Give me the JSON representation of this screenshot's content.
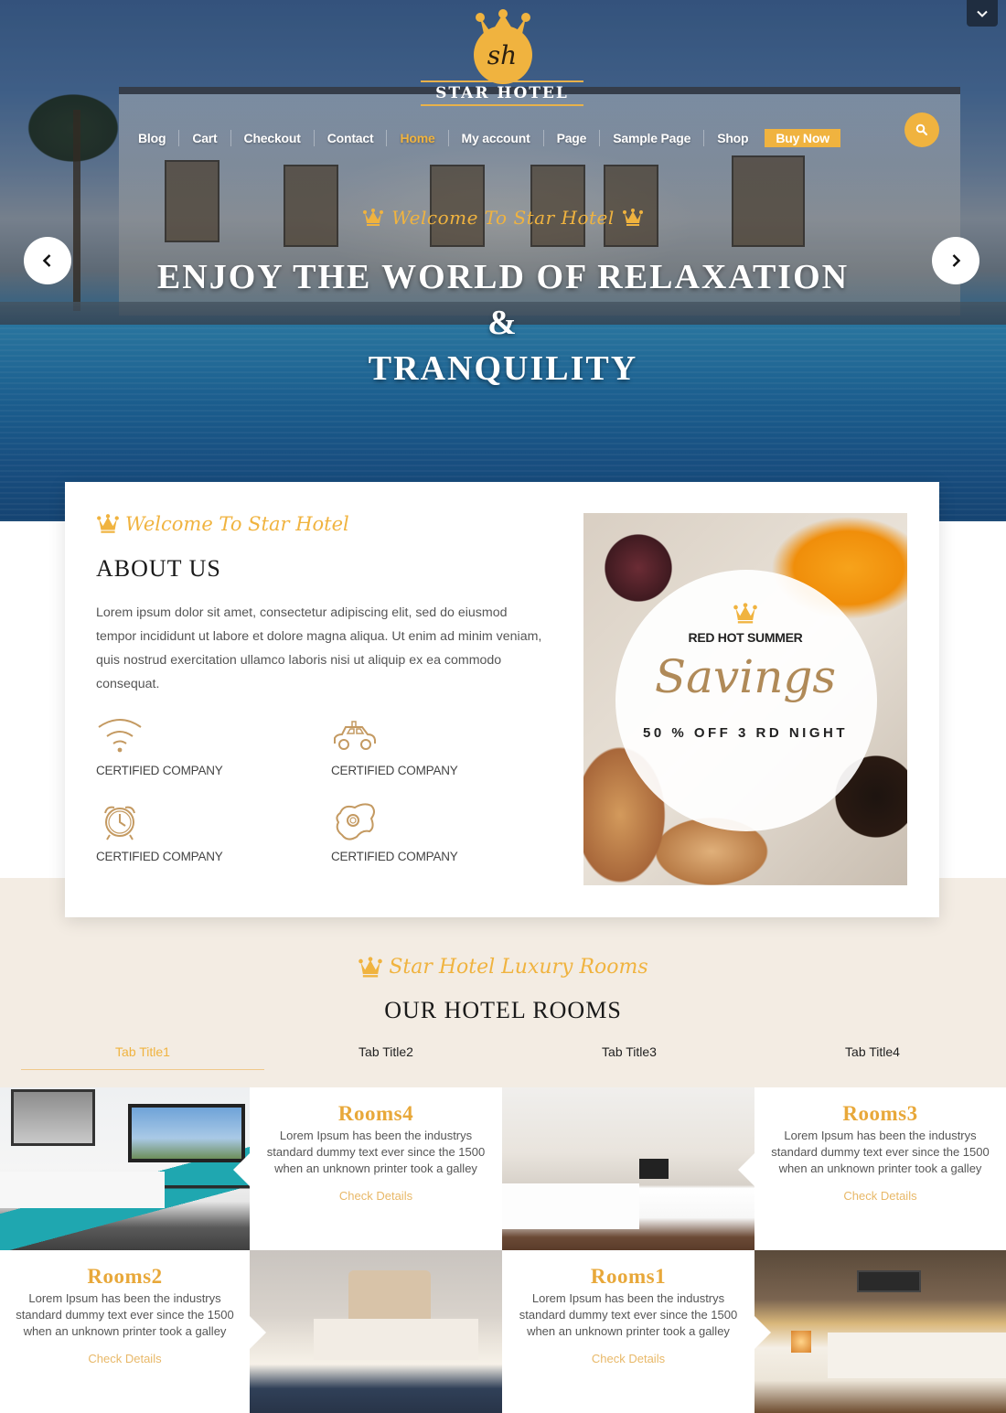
{
  "brand": {
    "initials": "sh",
    "name": "STAR HOTEL"
  },
  "colors": {
    "accent": "#f0b33f",
    "beige": "#f3ece3",
    "dark": "#1a1a1a",
    "icon_tan": "#c49a62"
  },
  "nav": {
    "items": [
      {
        "label": "Blog"
      },
      {
        "label": "Cart"
      },
      {
        "label": "Checkout"
      },
      {
        "label": "Contact"
      },
      {
        "label": "Home",
        "active": true
      },
      {
        "label": "My account"
      },
      {
        "label": "Page"
      },
      {
        "label": "Sample Page"
      },
      {
        "label": "Shop"
      }
    ],
    "buy_now": "Buy Now",
    "search_icon": "search-icon"
  },
  "hero": {
    "subtitle": "Welcome To Star Hotel",
    "title_line1": "ENJOY THE WORLD OF RELAXATION &",
    "title_line2": "TRANQUILITY",
    "prev_icon": "chevron-left-icon",
    "next_icon": "chevron-right-icon"
  },
  "about": {
    "subtitle": "Welcome To Star Hotel",
    "title": "ABOUT US",
    "text": "Lorem ipsum dolor sit amet, consectetur adipiscing elit, sed do eiusmod tempor incididunt ut labore et dolore magna aliqua. Ut enim ad minim veniam, quis nostrud exercitation ullamco laboris nisi ut aliquip ex ea commodo consequat.",
    "features": [
      {
        "icon": "wifi-icon",
        "label": "CERTIFIED COMPANY"
      },
      {
        "icon": "taxi-icon",
        "label": "CERTIFIED COMPANY"
      },
      {
        "icon": "alarm-clock-icon",
        "label": "CERTIFIED COMPANY"
      },
      {
        "icon": "fried-egg-icon",
        "label": "CERTIFIED COMPANY"
      }
    ],
    "promo": {
      "heading": "RED HOT SUMMER",
      "script": "Savings",
      "offer": "50 % OFF 3 RD NIGHT"
    }
  },
  "rooms": {
    "subtitle": "Star Hotel Luxury Rooms",
    "title": "OUR HOTEL ROOMS",
    "tabs": [
      {
        "label": "Tab Title1",
        "active": true
      },
      {
        "label": "Tab Title2"
      },
      {
        "label": "Tab Title3"
      },
      {
        "label": "Tab Title4"
      }
    ],
    "items": [
      {
        "name": "Rooms4",
        "desc": "Lorem Ipsum has been the industrys standard dummy text ever since the 1500 when an unknown printer took a galley",
        "link": "Check Details"
      },
      {
        "name": "Rooms3",
        "desc": "Lorem Ipsum has been the industrys standard dummy text ever since the 1500 when an unknown printer took a galley",
        "link": "Check Details"
      },
      {
        "name": "Rooms2",
        "desc": "Lorem Ipsum has been the industrys standard dummy text ever since the 1500 when an unknown printer took a galley",
        "link": "Check Details"
      },
      {
        "name": "Rooms1",
        "desc": "Lorem Ipsum has been the industrys standard dummy text ever since the 1500 when an unknown printer took a galley",
        "link": "Check Details"
      }
    ]
  }
}
